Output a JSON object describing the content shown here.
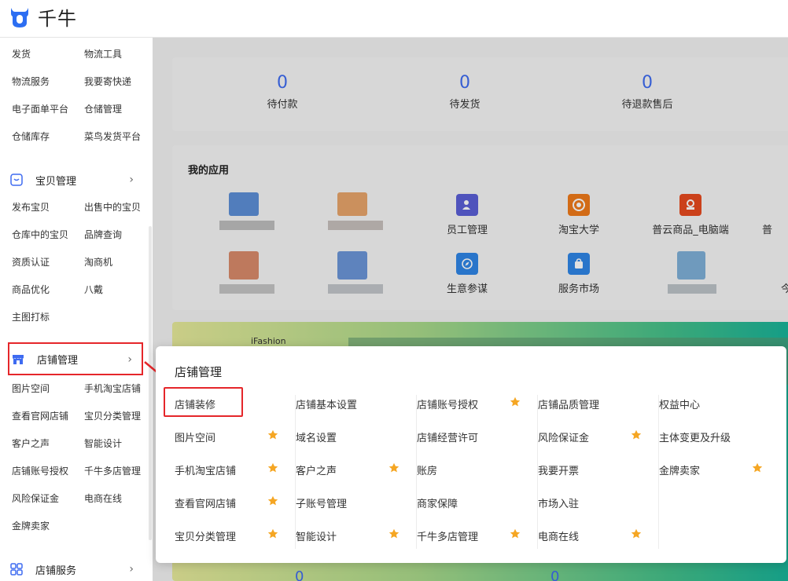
{
  "app": {
    "logo_text": "千牛"
  },
  "sidebar": {
    "logistics": [
      [
        "发货",
        "物流工具"
      ],
      [
        "物流服务",
        "我要寄快递"
      ],
      [
        "电子面单平台",
        "仓储管理"
      ],
      [
        "仓储库存",
        "菜鸟发货平台"
      ]
    ],
    "baobei_section": {
      "label": "宝贝管理",
      "chevron": "›"
    },
    "baobei_items": [
      [
        "发布宝贝",
        "出售中的宝贝"
      ],
      [
        "仓库中的宝贝",
        "品牌查询"
      ],
      [
        "资质认证",
        "淘商机"
      ],
      [
        "商品优化",
        "八戴"
      ],
      [
        "主图打标",
        ""
      ]
    ],
    "store_section": {
      "label": "店铺管理",
      "chevron": "›"
    },
    "store_items": [
      [
        "图片空间",
        "手机淘宝店铺"
      ],
      [
        "查看官网店铺",
        "宝贝分类管理"
      ],
      [
        "客户之声",
        "智能设计"
      ],
      [
        "店铺账号授权",
        "千牛多店管理"
      ],
      [
        "风险保证金",
        "电商在线"
      ],
      [
        "金牌卖家",
        ""
      ]
    ],
    "service_section": {
      "label": "店铺服务",
      "chevron": "›"
    }
  },
  "stats": [
    {
      "value": "0",
      "label": "待付款"
    },
    {
      "value": "0",
      "label": "待发货"
    },
    {
      "value": "0",
      "label": "待退款售后"
    }
  ],
  "apps": {
    "title": "我的应用",
    "named": [
      {
        "name": "员工管理",
        "icon": "staff-icon",
        "color": "#5b5fd6"
      },
      {
        "name": "淘宝大学",
        "icon": "taobao-university-icon",
        "color": "#f07a1a"
      },
      {
        "name": "普云商品_电脑端",
        "icon": "puyun-icon",
        "color": "#e84a1f"
      },
      {
        "name": "生意参谋",
        "icon": "compass-icon",
        "color": "#2f86e6"
      },
      {
        "name": "服务市场",
        "icon": "shopping-bag-icon",
        "color": "#2f86e6"
      }
    ],
    "cutoff_right_1": "普",
    "cutoff_right_2": "今"
  },
  "banner": {
    "text": "iFashion"
  },
  "lower_numbers": [
    "0",
    "0"
  ],
  "popup": {
    "title": "店铺管理",
    "columns": [
      [
        {
          "label": "店铺装修",
          "star": false
        },
        {
          "label": "图片空间",
          "star": true
        },
        {
          "label": "手机淘宝店铺",
          "star": true
        },
        {
          "label": "查看官网店铺",
          "star": true
        },
        {
          "label": "宝贝分类管理",
          "star": true
        }
      ],
      [
        {
          "label": "店铺基本设置",
          "star": false
        },
        {
          "label": "域名设置",
          "star": false
        },
        {
          "label": "客户之声",
          "star": true
        },
        {
          "label": "子账号管理",
          "star": false
        },
        {
          "label": "智能设计",
          "star": true
        }
      ],
      [
        {
          "label": "店铺账号授权",
          "star": true
        },
        {
          "label": "店铺经营许可",
          "star": false
        },
        {
          "label": "账房",
          "star": false
        },
        {
          "label": "商家保障",
          "star": false
        },
        {
          "label": "千牛多店管理",
          "star": true
        }
      ],
      [
        {
          "label": "店铺品质管理",
          "star": false
        },
        {
          "label": "风险保证金",
          "star": true
        },
        {
          "label": "我要开票",
          "star": false
        },
        {
          "label": "市场入驻",
          "star": false
        },
        {
          "label": "电商在线",
          "star": true
        }
      ],
      [
        {
          "label": "权益中心",
          "star": false
        },
        {
          "label": "主体变更及升级",
          "star": false
        },
        {
          "label": "金牌卖家",
          "star": true
        }
      ]
    ]
  },
  "colors": {
    "accent": "#3e6bf1",
    "highlight": "#e5262a",
    "star": "#f5a623"
  }
}
